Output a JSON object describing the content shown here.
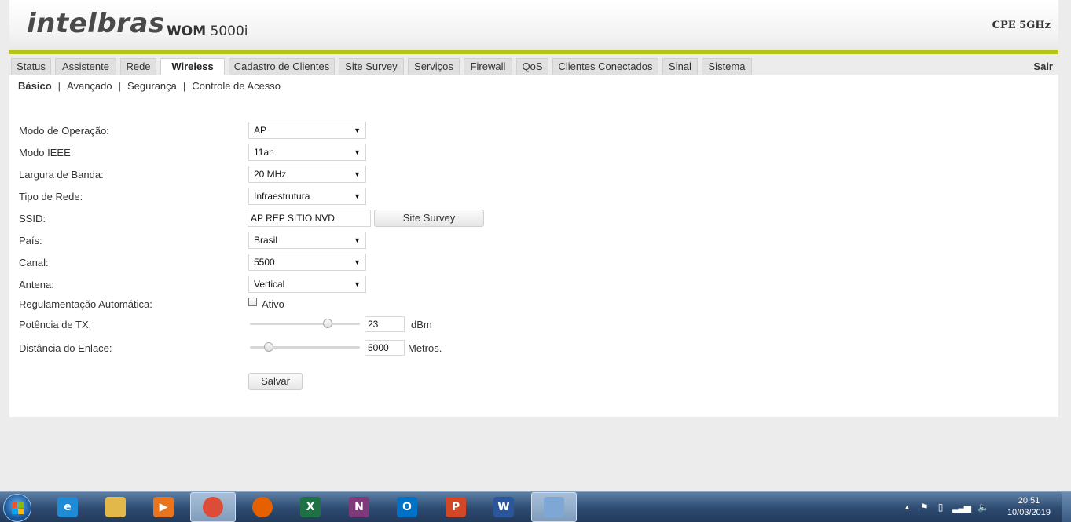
{
  "header": {
    "logo_text": "intelbras",
    "model_prefix": "WOM",
    "model_number": "5000i",
    "product": "CPE 5GHz"
  },
  "nav": {
    "tabs": [
      {
        "label": "Status"
      },
      {
        "label": "Assistente"
      },
      {
        "label": "Rede"
      },
      {
        "label": "Wireless",
        "active": true
      },
      {
        "label": "Cadastro de Clientes"
      },
      {
        "label": "Site Survey"
      },
      {
        "label": "Serviços"
      },
      {
        "label": "Firewall"
      },
      {
        "label": "QoS"
      },
      {
        "label": "Clientes Conectados"
      },
      {
        "label": "Sinal"
      },
      {
        "label": "Sistema"
      }
    ],
    "logout_label": "Sair"
  },
  "subnav": {
    "items": [
      {
        "label": "Básico",
        "active": true
      },
      {
        "label": "Avançado"
      },
      {
        "label": "Segurança"
      },
      {
        "label": "Controle de Acesso"
      }
    ],
    "separator": "|"
  },
  "form": {
    "modo_operacao": {
      "label": "Modo de Operação:",
      "value": "AP"
    },
    "modo_ieee": {
      "label": "Modo IEEE:",
      "value": "11an"
    },
    "largura_banda": {
      "label": "Largura de Banda:",
      "value": "20 MHz"
    },
    "tipo_rede": {
      "label": "Tipo de Rede:",
      "value": "Infraestrutura"
    },
    "ssid": {
      "label": "SSID:",
      "value": "AP REP SITIO NVD",
      "button": "Site Survey"
    },
    "pais": {
      "label": "País:",
      "value": "Brasil"
    },
    "canal": {
      "label": "Canal:",
      "value": "5500"
    },
    "antena": {
      "label": "Antena:",
      "value": "Vertical"
    },
    "regulamentacao": {
      "label": "Regulamentação Automática:",
      "checkbox_label": "Ativo",
      "checked": false
    },
    "potencia_tx": {
      "label": "Potência de TX:",
      "value": "23",
      "unit": "dBm",
      "slider_fraction": 0.73
    },
    "distancia": {
      "label": "Distância do Enlace:",
      "value": "5000",
      "unit": "Metros.",
      "slider_fraction": 0.14
    },
    "save_label": "Salvar"
  },
  "taskbar": {
    "apps": [
      {
        "name": "internet-explorer-icon",
        "glyph": "e",
        "color": "#1f8ad6"
      },
      {
        "name": "file-explorer-icon",
        "glyph": "",
        "color": "#e3b84a"
      },
      {
        "name": "media-player-icon",
        "glyph": "▶",
        "color": "#e8741e"
      },
      {
        "name": "chrome-icon",
        "glyph": "",
        "color": "#dd4b39",
        "active": true
      },
      {
        "name": "firefox-icon",
        "glyph": "",
        "color": "#e66000"
      },
      {
        "name": "excel-icon",
        "glyph": "X",
        "color": "#1e7145"
      },
      {
        "name": "onenote-icon",
        "glyph": "N",
        "color": "#80397b"
      },
      {
        "name": "outlook-icon",
        "glyph": "O",
        "color": "#0072c6"
      },
      {
        "name": "powerpoint-icon",
        "glyph": "P",
        "color": "#d24726"
      },
      {
        "name": "word-icon",
        "glyph": "W",
        "color": "#2b579a"
      },
      {
        "name": "paint-icon",
        "glyph": "",
        "color": "#7fa7d4",
        "active": true
      }
    ],
    "clock": {
      "time": "20:51",
      "date": "10/03/2019"
    }
  }
}
